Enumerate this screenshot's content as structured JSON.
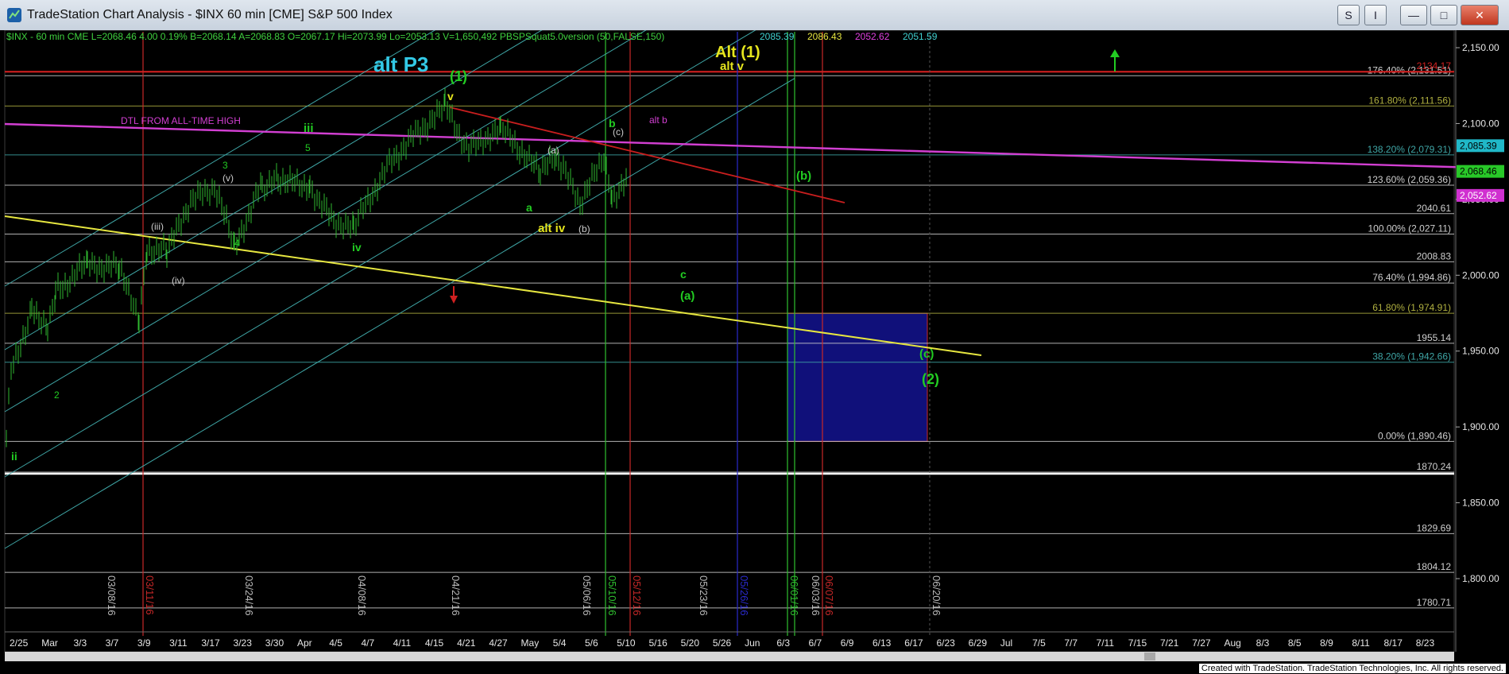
{
  "window": {
    "title": "TradeStation Chart Analysis - $INX 60 min [CME] S&P 500 Index",
    "buttons": {
      "s": "S",
      "i": "I",
      "minimize": "—",
      "maximize": "□",
      "close": "✕"
    },
    "footer": "Created with TradeStation. TradeStation Technologies, Inc. All rights reserved."
  },
  "colors": {
    "background": "#000000",
    "price_bars": "#2fb82f",
    "magenta_line": "#d23fd2",
    "yellow_line": "#e6e640",
    "red_line": "#c81e1e",
    "cyan_channel": "#3fa6a6",
    "white_line": "#ffffff",
    "green_label": "#22cc22",
    "yellow_label": "#e6e61e",
    "cyan_label": "#33c9e6",
    "box_fill": "#10107a"
  },
  "chart_data": {
    "type": "ohlc",
    "symbol": "$INX",
    "header": [
      {
        "text": "$INX - 60 min  CME  L=2068.46  4.00    0.19%  B=2068.14  A=2068.83  O=2067.17  Hi=2073.99  Lo=2053.13  V=1,650,492  PBSPSquat5.0version (50,FALSE,150)",
        "color": "#3fd03f"
      },
      {
        "text": "2085.39",
        "color": "#3fd0d0"
      },
      {
        "text": "2086.43",
        "color": "#e6e640"
      },
      {
        "text": "2052.62",
        "color": "#e040e0"
      },
      {
        "text": "2051.59",
        "color": "#3fd0d0"
      }
    ],
    "ylim": [
      1760,
      2160
    ],
    "y_ticks": [
      1800,
      1850,
      1900,
      1950,
      2000,
      2050,
      2100,
      2150
    ],
    "y_tick_labels": [
      "1,800.00",
      "1,850.00",
      "1,900.00",
      "1,950.00",
      "2,000.00",
      "2,050.00",
      "2,100.00",
      "2,150.00"
    ],
    "x_labels": [
      "2/25",
      "Mar",
      "3/3",
      "3/7",
      "3/9",
      "3/11",
      "3/17",
      "3/23",
      "3/30",
      "Apr",
      "4/5",
      "4/7",
      "4/11",
      "4/15",
      "4/21",
      "4/27",
      "May",
      "5/4",
      "5/6",
      "5/10",
      "5/16",
      "5/20",
      "5/26",
      "Jun",
      "6/3",
      "6/7",
      "6/9",
      "6/13",
      "6/17",
      "6/23",
      "6/29",
      "Jul",
      "7/5",
      "7/7",
      "7/11",
      "7/15",
      "7/21",
      "7/27",
      "Aug",
      "8/3",
      "8/5",
      "8/9",
      "8/11",
      "8/17",
      "8/23"
    ],
    "vertical_dates": [
      {
        "text": "03/08/16",
        "color": "#bbbbbb"
      },
      {
        "text": "03/11/16",
        "color": "#c82828"
      },
      {
        "text": "03/24/16",
        "color": "#bbbbbb"
      },
      {
        "text": "04/08/16",
        "color": "#bbbbbb"
      },
      {
        "text": "04/21/16",
        "color": "#bbbbbb"
      },
      {
        "text": "05/06/16",
        "color": "#bbbbbb"
      },
      {
        "text": "05/10/16",
        "color": "#2fc02f"
      },
      {
        "text": "05/12/16",
        "color": "#c82828"
      },
      {
        "text": "05/23/16",
        "color": "#bbbbbb"
      },
      {
        "text": "05/26/16",
        "color": "#2a2acc"
      },
      {
        "text": "06/01/16",
        "color": "#2fc02f"
      },
      {
        "text": "06/03/16",
        "color": "#bbbbbb"
      },
      {
        "text": "06/07/16",
        "color": "#c82828"
      },
      {
        "text": "06/20/16",
        "color": "#bbbbbb"
      }
    ],
    "fib_levels": [
      {
        "label": "176.40% (2,131.51)",
        "price": 2131.51,
        "color": "#cfcfcf"
      },
      {
        "label": "2134.17",
        "price": 2134.17,
        "color": "#d02020"
      },
      {
        "label": "161.80% (2,111.56)",
        "price": 2111.56,
        "color": "#b0b040"
      },
      {
        "label": "138.20% (2,079.31)",
        "price": 2079.31,
        "color": "#3fa6a6"
      },
      {
        "label": "123.60% (2,059.36)",
        "price": 2059.36,
        "color": "#cfcfcf"
      },
      {
        "label": "2040.61",
        "price": 2040.61,
        "color": "#cfcfcf"
      },
      {
        "label": "100.00% (2,027.11)",
        "price": 2027.11,
        "color": "#cfcfcf"
      },
      {
        "label": "2008.83",
        "price": 2008.83,
        "color": "#cfcfcf"
      },
      {
        "label": "76.40% (1,994.86)",
        "price": 1994.86,
        "color": "#cfcfcf"
      },
      {
        "label": "61.80% (1,974.91)",
        "price": 1974.91,
        "color": "#b0b040"
      },
      {
        "label": "1955.14",
        "price": 1955.14,
        "color": "#cfcfcf"
      },
      {
        "label": "38.20% (1,942.66)",
        "price": 1942.66,
        "color": "#3fa6a6"
      },
      {
        "label": "0.00% (1,890.46)",
        "price": 1890.46,
        "color": "#cfcfcf"
      },
      {
        "label": "1870.24",
        "price": 1870.24,
        "color": "#cfcfcf"
      },
      {
        "label": "1829.69",
        "price": 1829.69,
        "color": "#cfcfcf"
      },
      {
        "label": "1804.12",
        "price": 1804.12,
        "color": "#cfcfcf"
      },
      {
        "label": "1780.71",
        "price": 1780.71,
        "color": "#cfcfcf"
      }
    ],
    "price_tags": [
      {
        "text": "2,085.39",
        "price": 2085.39,
        "bg": "#20b8c8",
        "fg": "#000000"
      },
      {
        "text": "2,068.46",
        "price": 2068.46,
        "bg": "#28c828",
        "fg": "#000000"
      },
      {
        "text": "2,052.62",
        "price": 2052.62,
        "bg": "#d030d0",
        "fg": "#ffffff"
      }
    ],
    "wave_labels": [
      {
        "text": "alt  P3",
        "color": "#33c9e6",
        "size": 26,
        "weight": "bold"
      },
      {
        "text": "(1)",
        "color": "#22cc22",
        "size": 18,
        "weight": "bold"
      },
      {
        "text": "v",
        "color": "#e6e61e",
        "size": 14,
        "weight": "bold"
      },
      {
        "text": "Alt (1)",
        "color": "#e6e61e",
        "size": 20,
        "weight": "bold"
      },
      {
        "text": "alt v",
        "color": "#e6e61e",
        "size": 15,
        "weight": "bold"
      },
      {
        "text": "DTL FROM ALL-TIME HIGH",
        "color": "#d23fd2",
        "size": 12,
        "weight": "normal"
      },
      {
        "text": "iii",
        "color": "#22cc22",
        "size": 15,
        "weight": "bold"
      },
      {
        "text": "5",
        "color": "#22cc22",
        "size": 12,
        "weight": "normal"
      },
      {
        "text": "3",
        "color": "#22cc22",
        "size": 12,
        "weight": "normal"
      },
      {
        "text": "(v)",
        "color": "#cccccc",
        "size": 12,
        "weight": "normal"
      },
      {
        "text": "b",
        "color": "#22cc22",
        "size": 14,
        "weight": "bold"
      },
      {
        "text": "(c)",
        "color": "#cccccc",
        "size": 12,
        "weight": "normal"
      },
      {
        "text": "alt  b",
        "color": "#d23fd2",
        "size": 12,
        "weight": "normal"
      },
      {
        "text": "(a)",
        "color": "#cccccc",
        "size": 12,
        "weight": "normal"
      },
      {
        "text": "(b)",
        "color": "#22cc22",
        "size": 15,
        "weight": "bold"
      },
      {
        "text": "a",
        "color": "#22cc22",
        "size": 14,
        "weight": "bold"
      },
      {
        "text": "alt iv",
        "color": "#e6e61e",
        "size": 15,
        "weight": "bold"
      },
      {
        "text": "(b)",
        "color": "#cccccc",
        "size": 12,
        "weight": "normal"
      },
      {
        "text": "(iii)",
        "color": "#cccccc",
        "size": 12,
        "weight": "normal"
      },
      {
        "text": "4",
        "color": "#22cc22",
        "size": 12,
        "weight": "normal"
      },
      {
        "text": "iv",
        "color": "#22cc22",
        "size": 14,
        "weight": "bold"
      },
      {
        "text": "(iv)",
        "color": "#cccccc",
        "size": 12,
        "weight": "normal"
      },
      {
        "text": "c",
        "color": "#22cc22",
        "size": 14,
        "weight": "bold"
      },
      {
        "text": "(a)",
        "color": "#22cc22",
        "size": 15,
        "weight": "bold"
      },
      {
        "text": "(c)",
        "color": "#22cc22",
        "size": 15,
        "weight": "bold"
      },
      {
        "text": "(2)",
        "color": "#22cc22",
        "size": 18,
        "weight": "bold"
      },
      {
        "text": "2",
        "color": "#22cc22",
        "size": 12,
        "weight": "normal"
      },
      {
        "text": "ii",
        "color": "#22cc22",
        "size": 14,
        "weight": "bold"
      }
    ]
  }
}
